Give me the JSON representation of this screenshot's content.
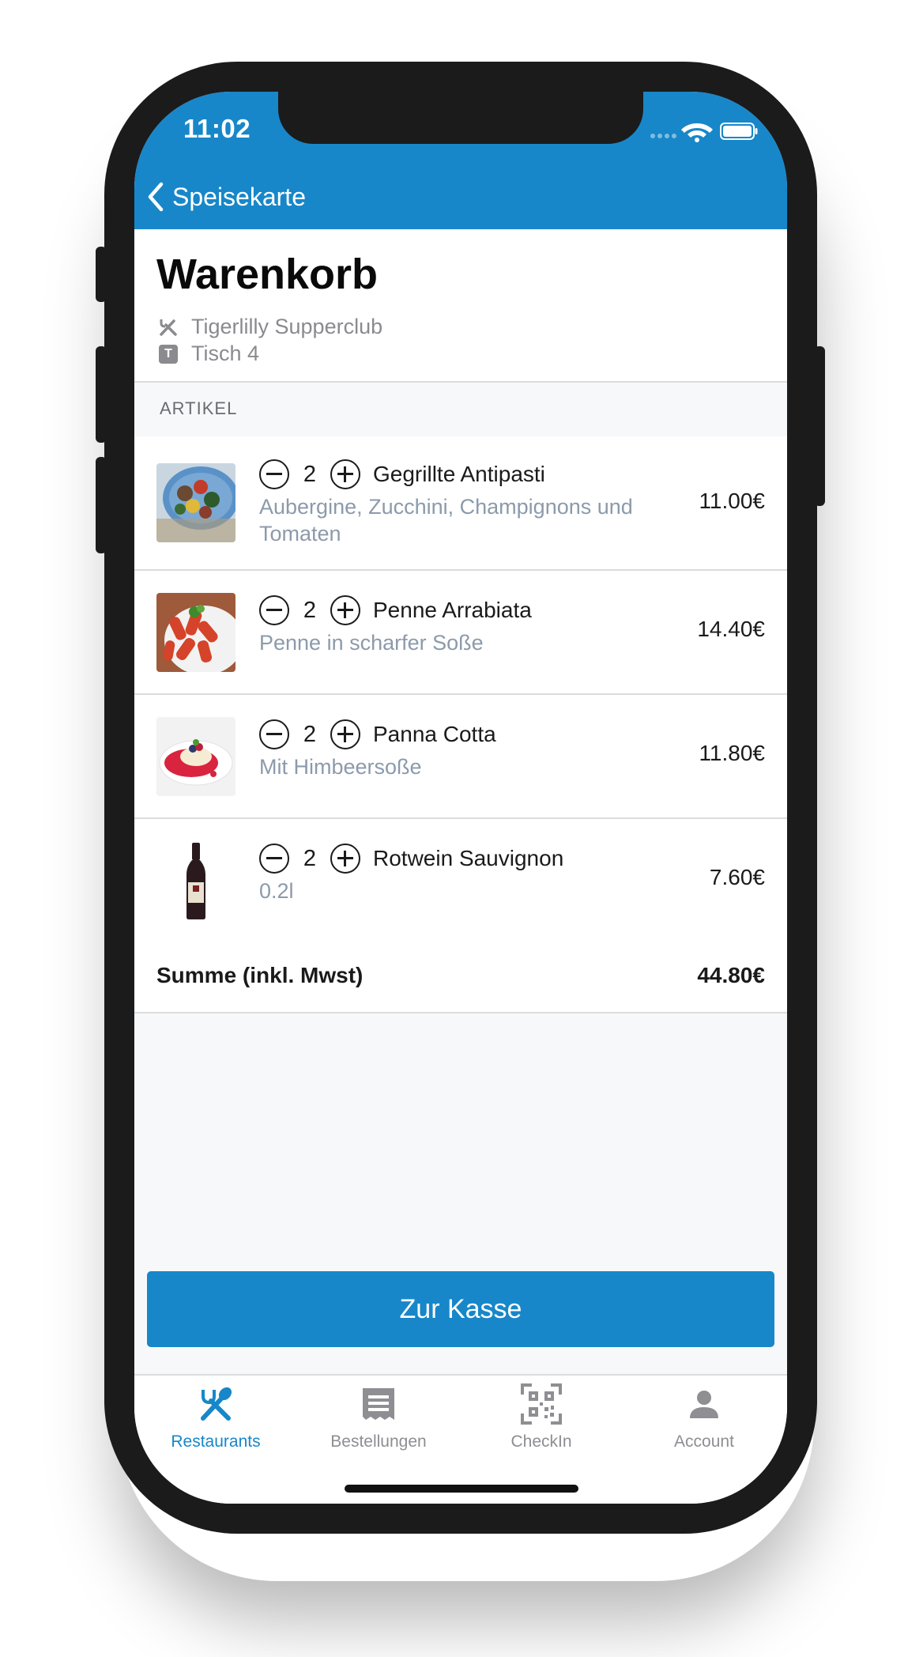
{
  "status_bar": {
    "time": "11:02"
  },
  "nav": {
    "back_label": "Speisekarte"
  },
  "header": {
    "title": "Warenkorb",
    "restaurant": "Tigerlilly Supperclub",
    "table": "Tisch 4",
    "table_badge": "T"
  },
  "section": {
    "label": "ARTIKEL"
  },
  "items": [
    {
      "qty": "2",
      "name": "Gegrillte Antipasti",
      "desc_line1": "Aubergine, Zucchini, Champignons und",
      "desc_line2": "Tomaten",
      "price": "11.00€"
    },
    {
      "qty": "2",
      "name": "Penne Arrabiata",
      "desc_line1": "Penne in scharfer Soße",
      "price": "14.40€"
    },
    {
      "qty": "2",
      "name": "Panna Cotta",
      "desc_line1": "Mit Himbeersoße",
      "price": "11.80€"
    },
    {
      "qty": "2",
      "name": "Rotwein Sauvignon",
      "desc_line1": "0.2l",
      "price": "7.60€"
    }
  ],
  "summary": {
    "label": "Summe (inkl. Mwst)",
    "total": "44.80€"
  },
  "checkout": {
    "label": "Zur Kasse"
  },
  "tabs": [
    {
      "label": "Restaurants",
      "icon": "cutlery-icon",
      "active": true
    },
    {
      "label": "Bestellungen",
      "icon": "receipt-icon",
      "active": false
    },
    {
      "label": "CheckIn",
      "icon": "qr-code-icon",
      "active": false
    },
    {
      "label": "Account",
      "icon": "user-icon",
      "active": false
    }
  ],
  "colors": {
    "brand": "#1787c9",
    "secondary_text": "#8c9aab",
    "inactive_tab": "#8e8e93"
  }
}
